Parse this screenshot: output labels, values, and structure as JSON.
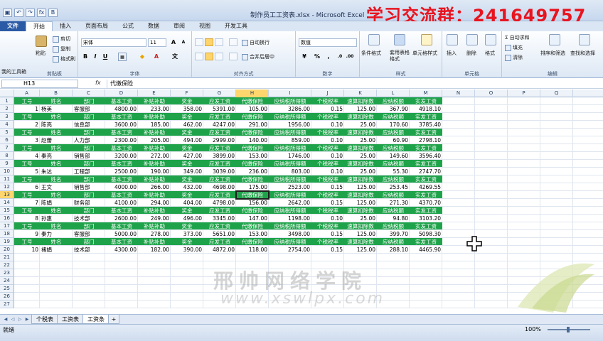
{
  "window": {
    "title": "制作员工工资表.xlsx - Microsoft Excel",
    "banner": "学习交流群：241649757"
  },
  "qat": [
    "save",
    "undo",
    "redo",
    "fx",
    "B"
  ],
  "tabs": [
    "文件",
    "开始",
    "插入",
    "页面布局",
    "公式",
    "数据",
    "审阅",
    "视图",
    "开发工具"
  ],
  "ribbon": {
    "clipboard": {
      "label": "剪贴板",
      "paste": "粘贴",
      "cut": "剪切",
      "copy": "复制",
      "painter": "格式刷"
    },
    "font": {
      "label": "字体",
      "name": "宋体",
      "size": "11",
      "bold": "B",
      "italic": "I",
      "underline": "U"
    },
    "alignment": {
      "label": "对齐方式",
      "wrap": "自动换行",
      "merge": "合并后居中"
    },
    "number": {
      "label": "数字",
      "format": "数值",
      "percent": "%",
      "comma": ","
    },
    "styles": {
      "label": "样式",
      "cond": "条件格式",
      "table": "套用表格格式",
      "cell": "单元格样式"
    },
    "cells": {
      "label": "单元格",
      "insert": "插入",
      "delete": "删除",
      "format": "格式"
    },
    "editing": {
      "label": "编辑",
      "autosum": "自动求和",
      "fill": "填充",
      "clear": "清除",
      "sort": "排序和筛选",
      "find": "查找和选择"
    },
    "mytools": "我的工具箱"
  },
  "formula": {
    "namebox": "H13",
    "fx": "fx",
    "content": "代缴保险"
  },
  "columns": [
    "A",
    "B",
    "C",
    "D",
    "E",
    "F",
    "G",
    "H",
    "I",
    "J",
    "K",
    "L",
    "M",
    "N",
    "O",
    "P",
    "Q"
  ],
  "selected_col": "H",
  "selected_row": 13,
  "header_labels": [
    "工号",
    "姓名",
    "部门",
    "基本工资",
    "补贴补助",
    "奖金",
    "应发工资",
    "代缴保险",
    "应纳税所得额",
    "个税税率",
    "速算扣除数",
    "应纳税额",
    "实发工资"
  ],
  "employees": [
    [
      "1",
      "杨美",
      "客服部",
      "4800.00",
      "233.00",
      "358.00",
      "5391.00",
      "105.00",
      "3286.00",
      "0.15",
      "125.00",
      "367.90",
      "4918.10"
    ],
    [
      "2",
      "陈亮",
      "信息部",
      "3600.00",
      "185.00",
      "462.00",
      "4247.00",
      "291.00",
      "1956.00",
      "0.10",
      "25.00",
      "170.60",
      "3785.40"
    ],
    [
      "3",
      "赵蕾",
      "人力部",
      "2300.00",
      "205.00",
      "494.00",
      "2999.00",
      "140.00",
      "859.00",
      "0.10",
      "25.00",
      "60.90",
      "2798.10"
    ],
    [
      "4",
      "秦亮",
      "销售部",
      "3200.00",
      "272.00",
      "427.00",
      "3899.00",
      "153.00",
      "1746.00",
      "0.10",
      "25.00",
      "149.60",
      "3596.40"
    ],
    [
      "5",
      "朱达",
      "工程部",
      "2500.00",
      "190.00",
      "349.00",
      "3039.00",
      "236.00",
      "803.00",
      "0.10",
      "25.00",
      "55.30",
      "2747.70"
    ],
    [
      "6",
      "王文",
      "销售部",
      "4000.00",
      "266.00",
      "432.00",
      "4698.00",
      "175.00",
      "2523.00",
      "0.15",
      "125.00",
      "253.45",
      "4269.55"
    ],
    [
      "7",
      "陈娟",
      "财务部",
      "4100.00",
      "294.00",
      "404.00",
      "4798.00",
      "156.00",
      "2642.00",
      "0.15",
      "125.00",
      "271.30",
      "4370.70"
    ],
    [
      "8",
      "孙惠",
      "技术部",
      "2600.00",
      "249.00",
      "496.00",
      "3345.00",
      "147.00",
      "1198.00",
      "0.10",
      "25.00",
      "94.80",
      "3103.20"
    ],
    [
      "9",
      "秦力",
      "客服部",
      "5000.00",
      "278.00",
      "373.00",
      "5651.00",
      "153.00",
      "3498.00",
      "0.15",
      "125.00",
      "399.70",
      "5098.30"
    ],
    [
      "10",
      "褚娟",
      "技术部",
      "4300.00",
      "182.00",
      "390.00",
      "4872.00",
      "118.00",
      "2754.00",
      "0.15",
      "125.00",
      "288.10",
      "4465.90"
    ]
  ],
  "watermark": {
    "line1": "邢帅网络学院",
    "line2": "www.xswlpx.com"
  },
  "sheets": [
    "个税表",
    "工资表",
    "工资条"
  ],
  "active_sheet": "工资条",
  "status": {
    "left": "就绪",
    "zoom": "100%"
  },
  "colors": {
    "header_green": "#1fa34a",
    "selection": "#ffd56e",
    "banner_red": "#e8141f"
  }
}
